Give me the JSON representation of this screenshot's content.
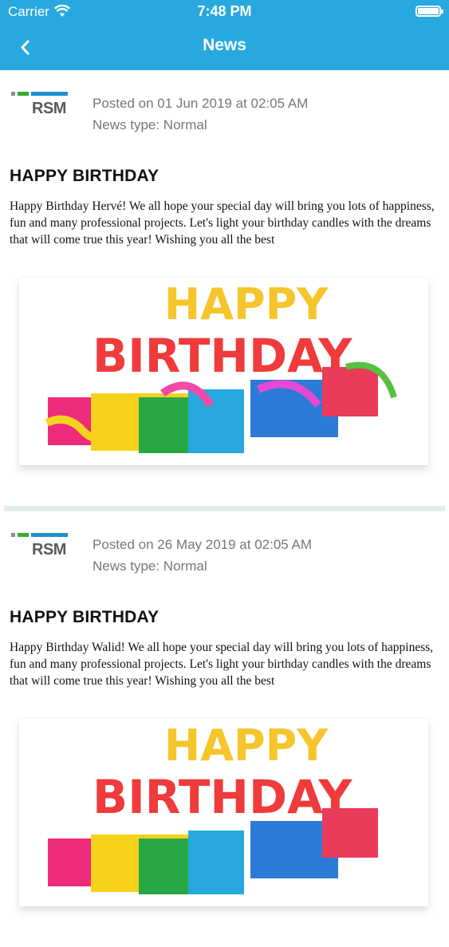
{
  "status_bar": {
    "carrier": "Carrier",
    "time": "7:48 PM"
  },
  "nav": {
    "title": "News"
  },
  "posts": [
    {
      "logo_text": "RSM",
      "posted": "Posted on 01 Jun 2019 at 02:05 AM",
      "news_type": "News type: Normal",
      "headline": "HAPPY BIRTHDAY",
      "body": "Happy Birthday Hervé! We all hope your special day will bring you lots of happiness, fun and many professional projects. Let's light your birthday candles with the dreams that will come true this year! Wishing you all the best",
      "image_word_top": "HAPPY",
      "image_word_bottom": "BIRTHDAY"
    },
    {
      "logo_text": "RSM",
      "posted": "Posted on 26 May 2019 at 02:05 AM",
      "news_type": "News type: Normal",
      "headline": "HAPPY BIRTHDAY",
      "body": "Happy Birthday Walid! We all hope your special day will bring you lots of happiness, fun and many professional projects. Let's light your birthday candles with the dreams that will come true this year! Wishing you all the best",
      "image_word_top": "HAPPY",
      "image_word_bottom": "BIRTHDAY"
    }
  ]
}
